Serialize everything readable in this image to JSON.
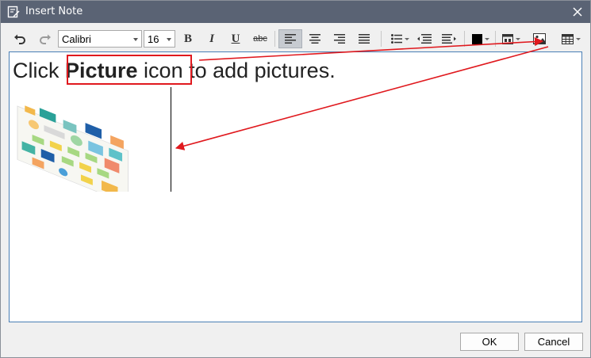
{
  "window": {
    "title": "Insert Note"
  },
  "toolbar": {
    "font_family": "Calibri",
    "font_size": "16",
    "bold_glyph": "B",
    "italic_glyph": "I",
    "underline_glyph": "U",
    "strike_glyph": "abc"
  },
  "editor": {
    "text_before": "Click ",
    "text_bold": "Picture",
    "text_after": " icon to add pictures."
  },
  "buttons": {
    "ok": "OK",
    "cancel": "Cancel"
  },
  "colors": {
    "titlebar": "#5a6374",
    "annotation": "#e0191e",
    "editor_border": "#4a7fb5"
  }
}
